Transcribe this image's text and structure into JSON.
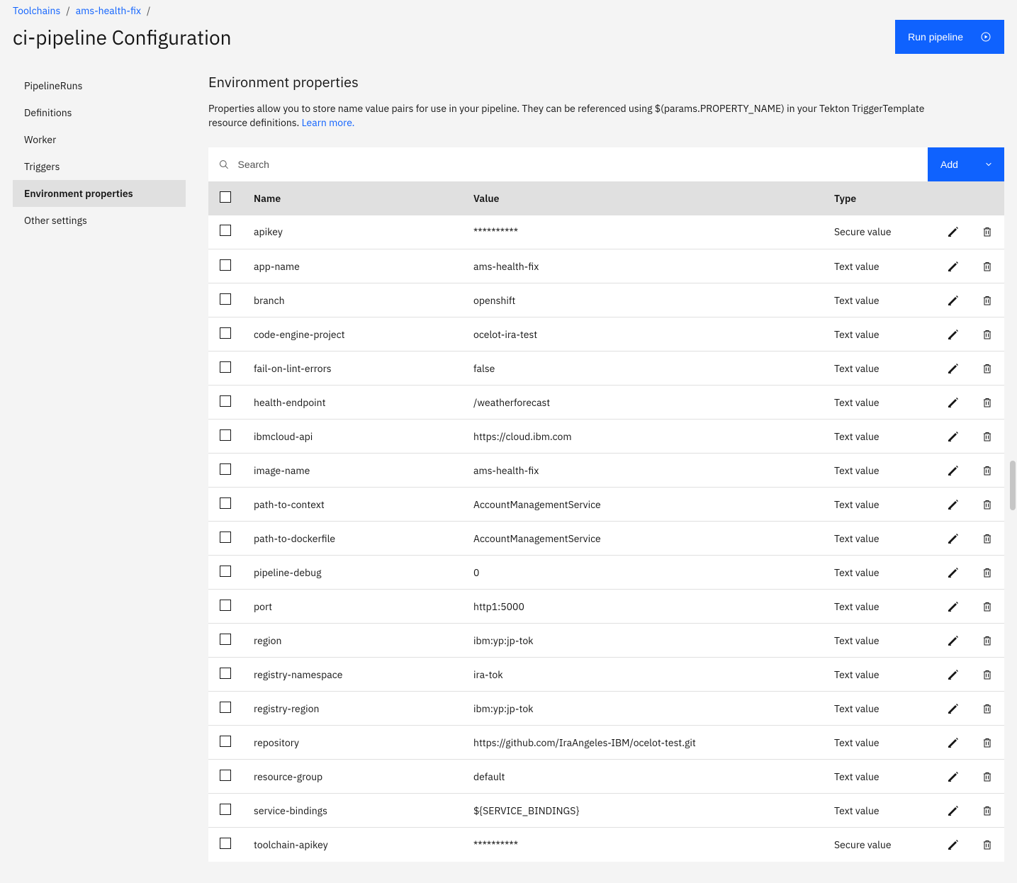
{
  "breadcrumb": {
    "item0": "Toolchains",
    "item1": "ams-health-fix"
  },
  "header": {
    "title": "ci-pipeline Configuration",
    "run_label": "Run pipeline"
  },
  "sidebar": {
    "items": [
      {
        "label": "PipelineRuns"
      },
      {
        "label": "Definitions"
      },
      {
        "label": "Worker"
      },
      {
        "label": "Triggers"
      },
      {
        "label": "Environment properties"
      },
      {
        "label": "Other settings"
      }
    ]
  },
  "section": {
    "title": "Environment properties",
    "desc": "Properties allow you to store name value pairs for use in your pipeline. They can be referenced using $(params.PROPERTY_NAME) in your Tekton TriggerTemplate resource definitions. ",
    "learn_more": "Learn more."
  },
  "toolbar": {
    "search_placeholder": "Search",
    "add_label": "Add"
  },
  "table": {
    "headers": {
      "name": "Name",
      "value": "Value",
      "type": "Type"
    },
    "rows": [
      {
        "name": "apikey",
        "value": "**********",
        "type": "Secure value"
      },
      {
        "name": "app-name",
        "value": "ams-health-fix",
        "type": "Text value"
      },
      {
        "name": "branch",
        "value": "openshift",
        "type": "Text value"
      },
      {
        "name": "code-engine-project",
        "value": "ocelot-ira-test",
        "type": "Text value"
      },
      {
        "name": "fail-on-lint-errors",
        "value": "false",
        "type": "Text value"
      },
      {
        "name": "health-endpoint",
        "value": "/weatherforecast",
        "type": "Text value"
      },
      {
        "name": "ibmcloud-api",
        "value": "https://cloud.ibm.com",
        "type": "Text value"
      },
      {
        "name": "image-name",
        "value": "ams-health-fix",
        "type": "Text value"
      },
      {
        "name": "path-to-context",
        "value": "AccountManagementService",
        "type": "Text value"
      },
      {
        "name": "path-to-dockerfile",
        "value": "AccountManagementService",
        "type": "Text value"
      },
      {
        "name": "pipeline-debug",
        "value": "0",
        "type": "Text value"
      },
      {
        "name": "port",
        "value": "http1:5000",
        "type": "Text value"
      },
      {
        "name": "region",
        "value": "ibm:yp:jp-tok",
        "type": "Text value"
      },
      {
        "name": "registry-namespace",
        "value": "ira-tok",
        "type": "Text value"
      },
      {
        "name": "registry-region",
        "value": "ibm:yp:jp-tok",
        "type": "Text value"
      },
      {
        "name": "repository",
        "value": "https://github.com/IraAngeles-IBM/ocelot-test.git",
        "type": "Text value"
      },
      {
        "name": "resource-group",
        "value": "default",
        "type": "Text value"
      },
      {
        "name": "service-bindings",
        "value": "${SERVICE_BINDINGS}",
        "type": "Text value"
      },
      {
        "name": "toolchain-apikey",
        "value": "**********",
        "type": "Secure value"
      }
    ]
  }
}
